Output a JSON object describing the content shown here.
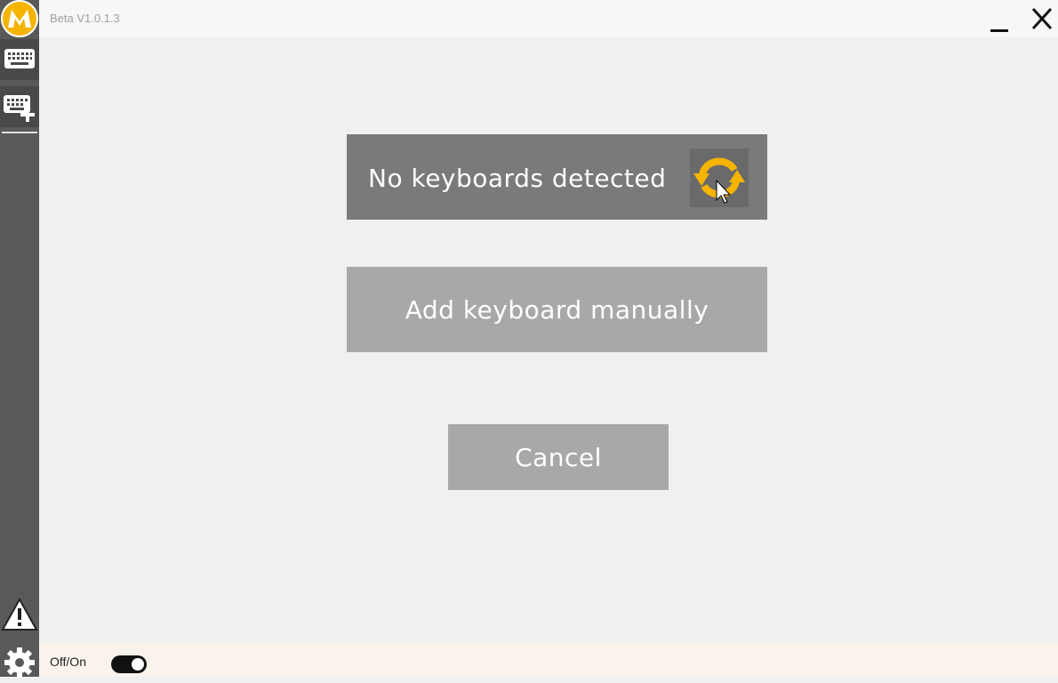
{
  "app": {
    "version": "Beta V1.0.1.3",
    "logo_letter": "M",
    "accent_color": "#f5b400"
  },
  "window_controls": {
    "minimize_icon": "minimize-icon",
    "close_icon": "close-icon"
  },
  "sidebar": {
    "items": [
      {
        "icon": "keyboard-icon"
      },
      {
        "icon": "keyboard-add-icon"
      },
      {
        "icon": "warning-icon"
      },
      {
        "icon": "gear-icon"
      }
    ]
  },
  "main": {
    "detect_label": "No keyboards detected",
    "refresh_icon": "refresh-icon",
    "add_label": "Add keyboard manually",
    "cancel_label": "Cancel"
  },
  "footer": {
    "toggle_label": "Off/On",
    "toggle_state": "on"
  }
}
